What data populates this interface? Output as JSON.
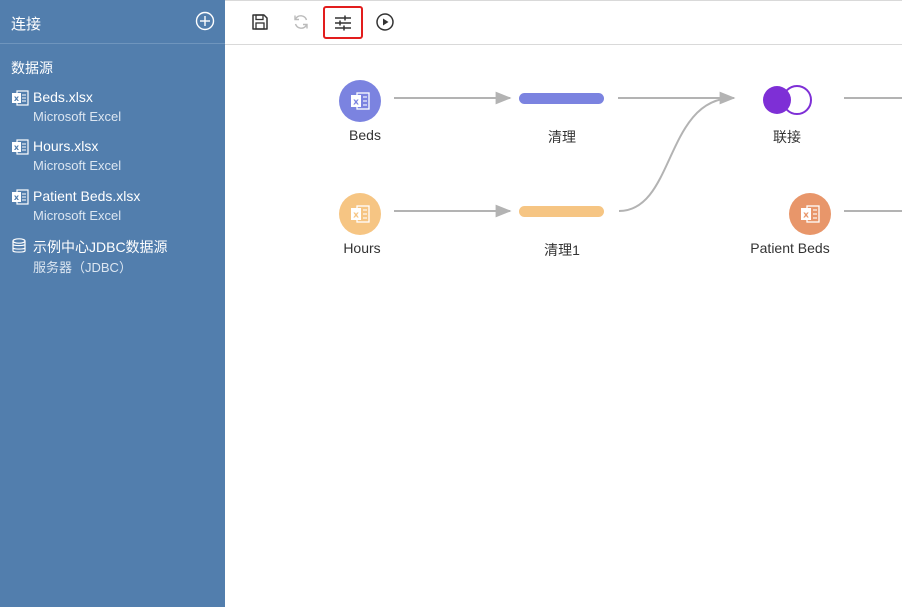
{
  "sidebar": {
    "title": "连接",
    "section": "数据源",
    "items": [
      {
        "name": "Beds.xlsx",
        "sub": "Microsoft Excel",
        "icon": "excel-icon"
      },
      {
        "name": "Hours.xlsx",
        "sub": "Microsoft Excel",
        "icon": "excel-icon"
      },
      {
        "name": "Patient Beds.xlsx",
        "sub": "Microsoft Excel",
        "icon": "excel-icon"
      },
      {
        "name": "示例中心JDBC数据源",
        "sub": "服务器（JDBC）",
        "icon": "database-icon"
      }
    ]
  },
  "toolbar": {
    "buttons": [
      {
        "name": "save",
        "icon": "save-icon"
      },
      {
        "name": "refresh",
        "icon": "refresh-icon"
      },
      {
        "name": "settings",
        "icon": "sliders-icon",
        "highlighted": true
      },
      {
        "name": "run",
        "icon": "play-icon"
      }
    ]
  },
  "flow": {
    "nodes": {
      "beds": {
        "label": "Beds",
        "color": "#7b83e0"
      },
      "clean": {
        "label": "清理",
        "color": "#7b83e0"
      },
      "join": {
        "label": "联接",
        "color": "#7e2fd6"
      },
      "hours": {
        "label": "Hours",
        "color": "#f6c583"
      },
      "clean1": {
        "label": "清理1",
        "color": "#f6c583"
      },
      "patient_beds": {
        "label": "Patient Beds",
        "color": "#e8966a"
      }
    },
    "edge_color": "#b3b3b3"
  }
}
